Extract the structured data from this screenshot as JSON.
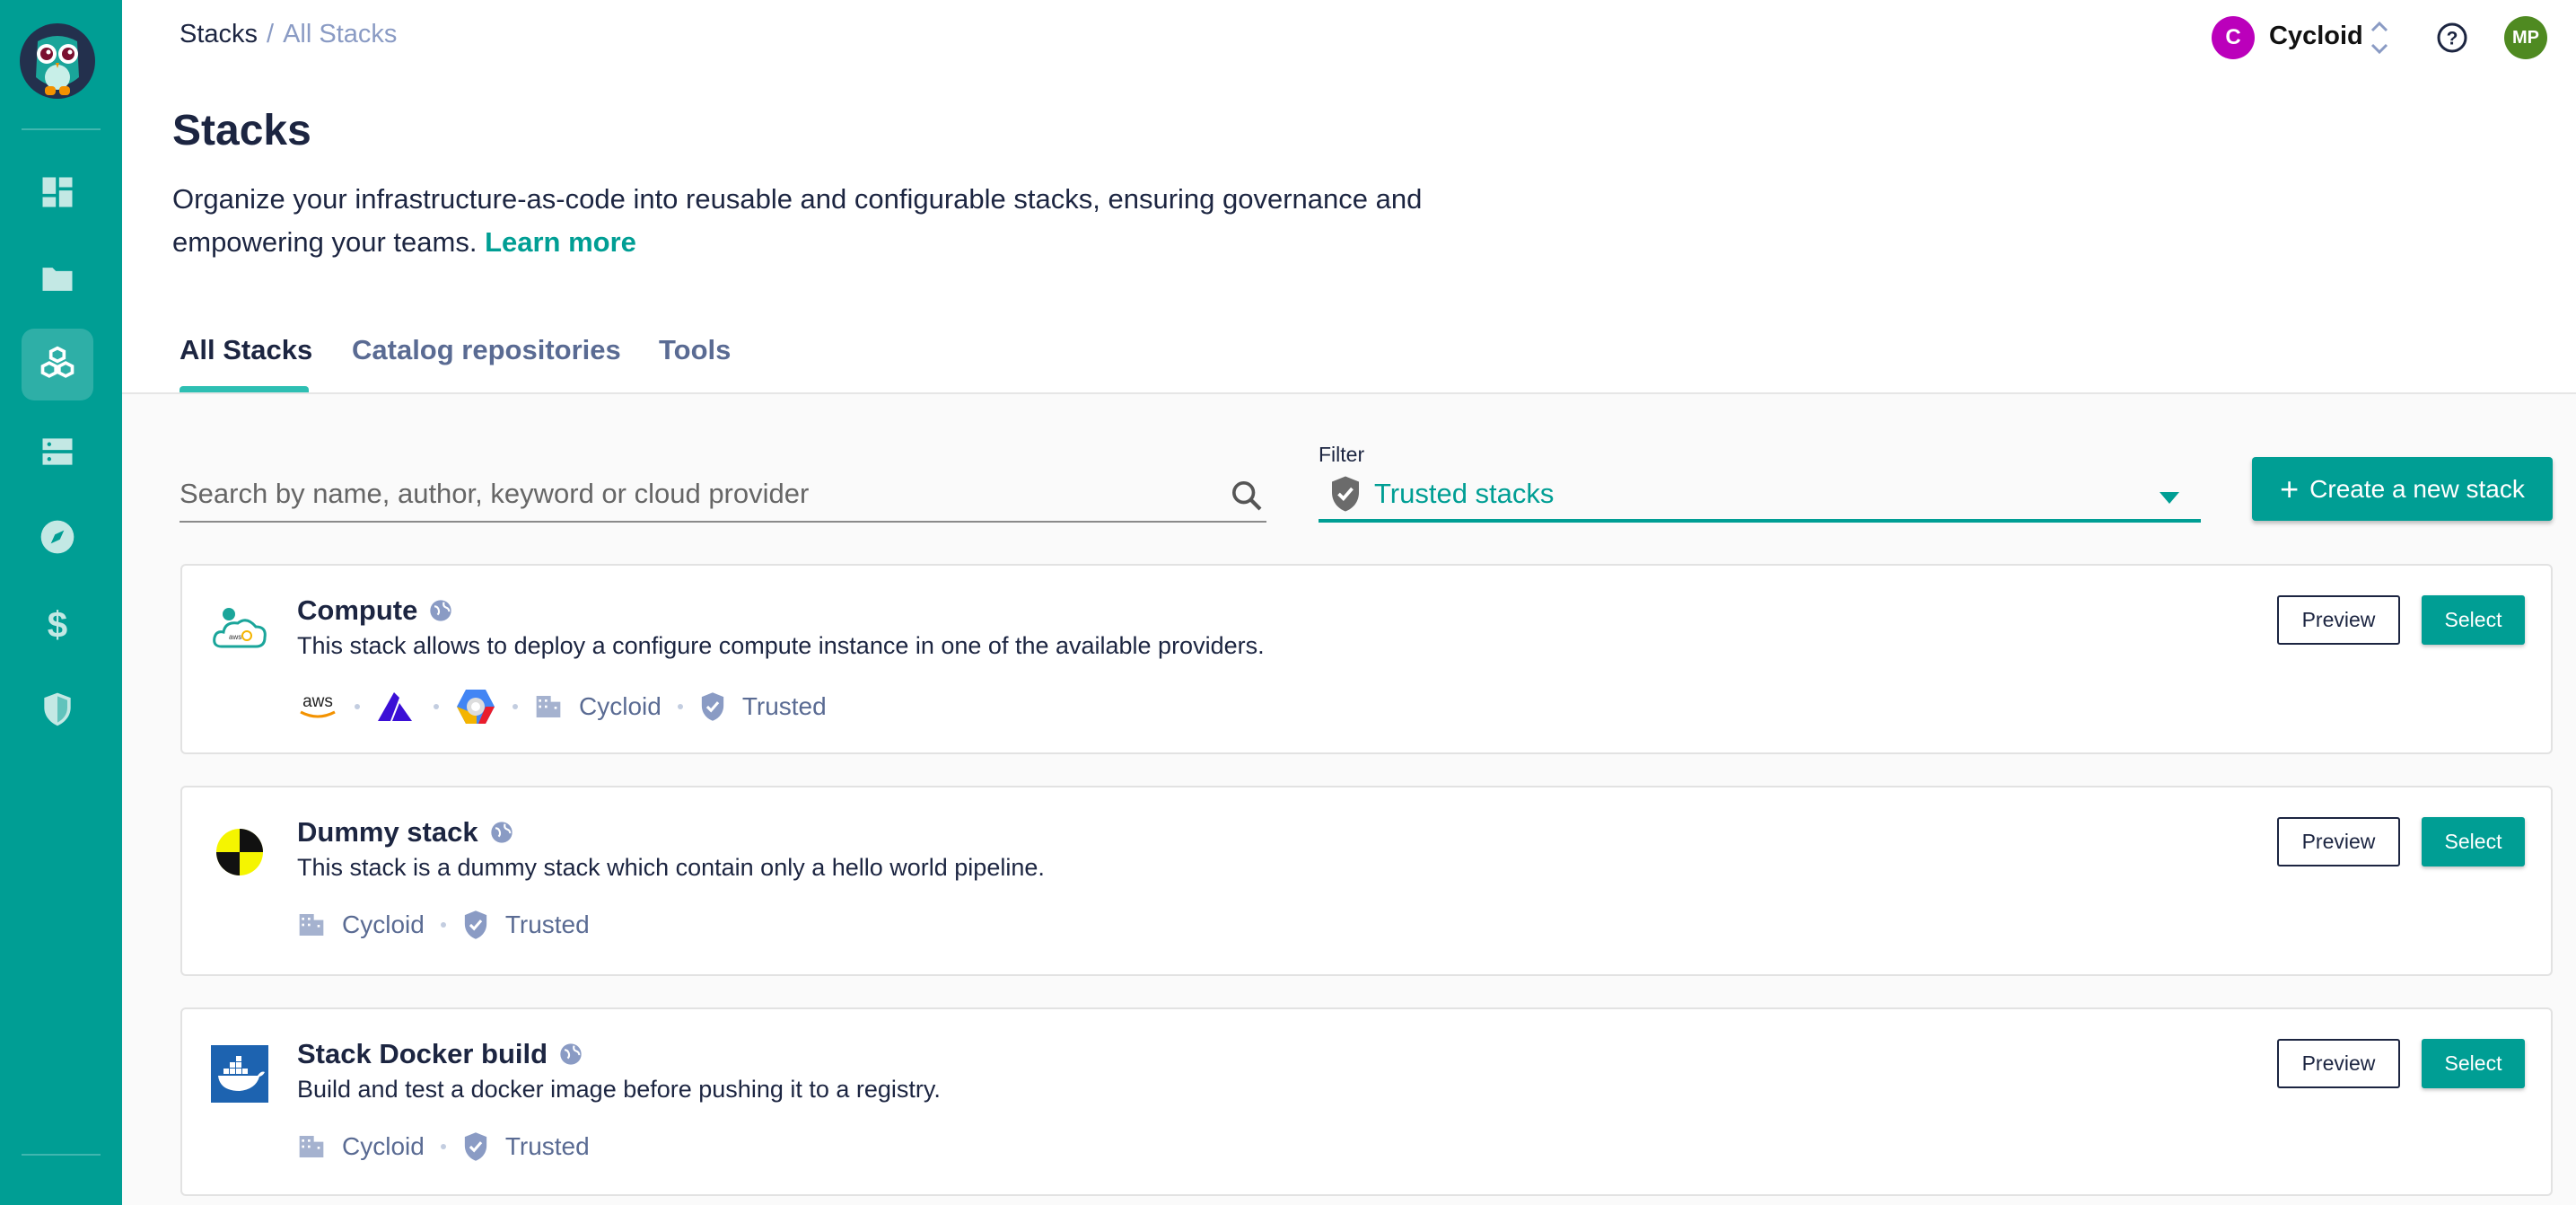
{
  "colors": {
    "accent": "#009e94",
    "sidebar": "#009e94",
    "org_avatar": "#bb00bb",
    "user_avatar": "#4f8a21"
  },
  "sidebar": {
    "items": [
      {
        "icon": "dashboard-icon",
        "label": "Dashboard"
      },
      {
        "icon": "folder-icon",
        "label": "Projects"
      },
      {
        "icon": "cubes-icon",
        "label": "Stacks",
        "active": true
      },
      {
        "icon": "server-icon",
        "label": "Infrastructure"
      },
      {
        "icon": "compass-icon",
        "label": "Explore"
      },
      {
        "icon": "dollar-icon",
        "label": "Cost"
      },
      {
        "icon": "shield-icon",
        "label": "Security"
      }
    ]
  },
  "breadcrumb": {
    "root": "Stacks",
    "separator": "/",
    "current": "All Stacks"
  },
  "header": {
    "org_initial": "C",
    "org_name": "Cycloid",
    "user_initials": "MP"
  },
  "page": {
    "title": "Stacks",
    "description": "Organize your infrastructure-as-code into reusable and configurable stacks, ensuring governance and empowering your teams.",
    "learn_more": "Learn more"
  },
  "tabs": [
    {
      "label": "All Stacks",
      "active": true
    },
    {
      "label": "Catalog repositories"
    },
    {
      "label": "Tools"
    }
  ],
  "search": {
    "placeholder": "Search by name, author, keyword or cloud provider",
    "value": ""
  },
  "filter": {
    "label": "Filter",
    "value": "Trusted stacks"
  },
  "create_button": "Create a new stack",
  "stacks": [
    {
      "name": "Compute",
      "description": "This stack allows to deploy a configure compute instance in one of the available providers.",
      "providers": [
        "aws",
        "azure",
        "gcp"
      ],
      "author": "Cycloid",
      "badge": "Trusted",
      "preview": "Preview",
      "select": "Select"
    },
    {
      "name": "Dummy stack",
      "description": "This stack is a dummy stack which contain only a hello world pipeline.",
      "author": "Cycloid",
      "badge": "Trusted",
      "preview": "Preview",
      "select": "Select"
    },
    {
      "name": "Stack Docker build",
      "description": "Build and test a docker image before pushing it to a registry.",
      "author": "Cycloid",
      "badge": "Trusted",
      "preview": "Preview",
      "select": "Select"
    }
  ]
}
